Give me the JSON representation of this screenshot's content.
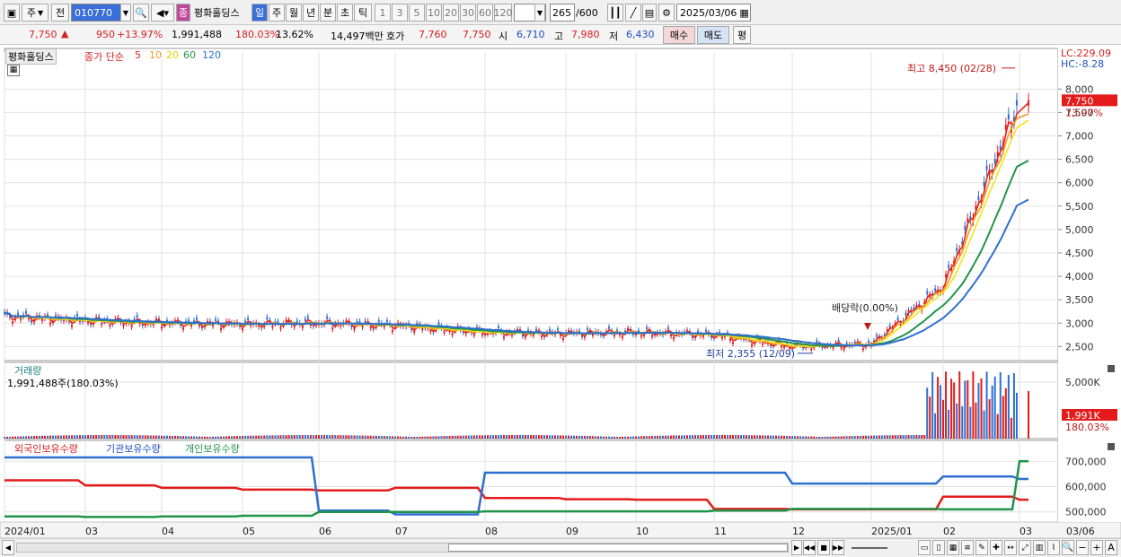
{
  "toolbar": {
    "market": "주",
    "prev": "전",
    "code": "010770",
    "badge": "종",
    "stock_name": "평화홀딩스",
    "period_tabs": [
      "일",
      "주",
      "월",
      "년",
      "분",
      "초",
      "틱"
    ],
    "intervals": [
      "1",
      "3",
      "5",
      "10",
      "20",
      "30",
      "60",
      "120"
    ],
    "count": "265",
    "count_max": "/600",
    "date": "2025/03/06"
  },
  "quote": {
    "price": "7,750",
    "change": "950",
    "change_pct": "+13.97%",
    "volume": "1,991,488",
    "volume_ratio": "180.03%",
    "turnover": "13.62%",
    "amount": "14,497백만",
    "ask_label": "호가",
    "ask": "7,760",
    "bid": "7,750",
    "open_label": "시",
    "open": "6,710",
    "high_label": "고",
    "high": "7,980",
    "low_label": "저",
    "low": "6,430",
    "buy": "매수",
    "sell": "매도",
    "eval": "평"
  },
  "price_panel": {
    "name": "평화홀딩스",
    "legend_prefix": "종가 단순",
    "ma_labels": [
      "5",
      "10",
      "20",
      "60",
      "120"
    ],
    "ma_colors": [
      "#e8231f",
      "#f29a1a",
      "#f2e31a",
      "#21944a",
      "#2f6fd0"
    ],
    "lc": "LC:229.09",
    "hc": "HC:-8.28",
    "yticks": [
      "8,000",
      "7,500",
      "7,000",
      "6,500",
      "6,000",
      "5,500",
      "5,000",
      "4,500",
      "4,000",
      "3,500",
      "3,000",
      "2,500"
    ],
    "last_price_tag": "7,750",
    "last_pct_tag": "13.97%",
    "high_annot": "최고 8,450 (02/28)",
    "low_annot": "최저 2,355 (12/09)",
    "dividend_annot": "배당락(0.00%)"
  },
  "volume_panel": {
    "title": "거래량",
    "value": "1,991,488주(180.03%)",
    "ytick": "5,000K",
    "tag_value": "1,991K",
    "tag_pct": "180.03%"
  },
  "holdings_panel": {
    "series": [
      "외국인보유수량",
      "기관보유수량",
      "개인보유수량"
    ],
    "colors": [
      "#e31b1b",
      "#2f6fd0",
      "#21944a"
    ],
    "yticks": [
      "700,000",
      "600,000",
      "500,000"
    ]
  },
  "xaxis": {
    "labels": [
      "2024/01",
      "03",
      "04",
      "05",
      "06",
      "07",
      "08",
      "09",
      "10",
      "11",
      "12",
      "2025/01",
      "02",
      "03",
      "03/06"
    ]
  },
  "chart_data": {
    "type": "line",
    "title": "평화홀딩스",
    "x": [
      "2024/01",
      "03",
      "04",
      "05",
      "06",
      "07",
      "08",
      "09",
      "10",
      "11",
      "12",
      "2025/01",
      "02",
      "03"
    ],
    "series": [
      {
        "name": "종가",
        "values": [
          3150,
          3050,
          3000,
          2980,
          3000,
          2950,
          2800,
          2780,
          2800,
          2750,
          2500,
          2550,
          3800,
          7750
        ]
      },
      {
        "name": "외국인보유수량",
        "values": [
          625000,
          605000,
          595000,
          588000,
          585000,
          595000,
          555000,
          550000,
          548000,
          512000,
          510000,
          510000,
          560000,
          548000
        ]
      },
      {
        "name": "기관보유수량",
        "values": [
          715000,
          715000,
          715000,
          715000,
          505000,
          490000,
          655000,
          655000,
          655000,
          655000,
          612000,
          612000,
          640000,
          630000
        ]
      },
      {
        "name": "개인보유수량",
        "values": [
          482000,
          480000,
          482000,
          485000,
          500000,
          500000,
          502000,
          502000,
          502000,
          505000,
          512000,
          512000,
          510000,
          700000
        ]
      }
    ],
    "ylim": [
      2200,
      8600
    ],
    "high": 8450,
    "low": 2355
  }
}
